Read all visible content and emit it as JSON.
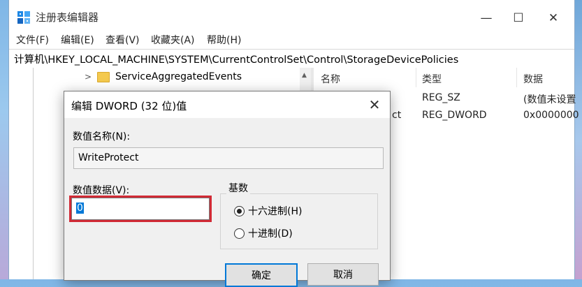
{
  "window": {
    "title": "注册表编辑器",
    "controls": {
      "minimize": "—",
      "maximize": "☐",
      "close": "✕"
    }
  },
  "menu": [
    "文件(F)",
    "编辑(E)",
    "查看(V)",
    "收藏夹(A)",
    "帮助(H)"
  ],
  "address": "计算机\\HKEY_LOCAL_MACHINE\\SYSTEM\\CurrentControlSet\\Control\\StorageDevicePolicies",
  "tree": {
    "items": [
      {
        "label": "ServiceAggregatedEvents",
        "expanded": false
      }
    ]
  },
  "list": {
    "headers": {
      "name": "名称",
      "type": "类型",
      "data": "数据"
    },
    "rows": [
      {
        "name": "",
        "type": "REG_SZ",
        "data": "(数值未设置"
      },
      {
        "name": "ct",
        "type": "REG_DWORD",
        "data": "0x0000000"
      }
    ]
  },
  "dialog": {
    "title": "编辑 DWORD (32 位)值",
    "close": "✕",
    "name_label": "数值名称(N):",
    "name_value": "WriteProtect",
    "data_label": "数值数据(V):",
    "data_value": "0",
    "base_label": "基数",
    "base_options": [
      {
        "label": "十六进制(H)",
        "selected": true
      },
      {
        "label": "十进制(D)",
        "selected": false
      }
    ],
    "ok": "确定",
    "cancel": "取消"
  },
  "colors": {
    "accent": "#0078d7",
    "highlight": "#d12a35",
    "folder": "#f4c94e"
  }
}
